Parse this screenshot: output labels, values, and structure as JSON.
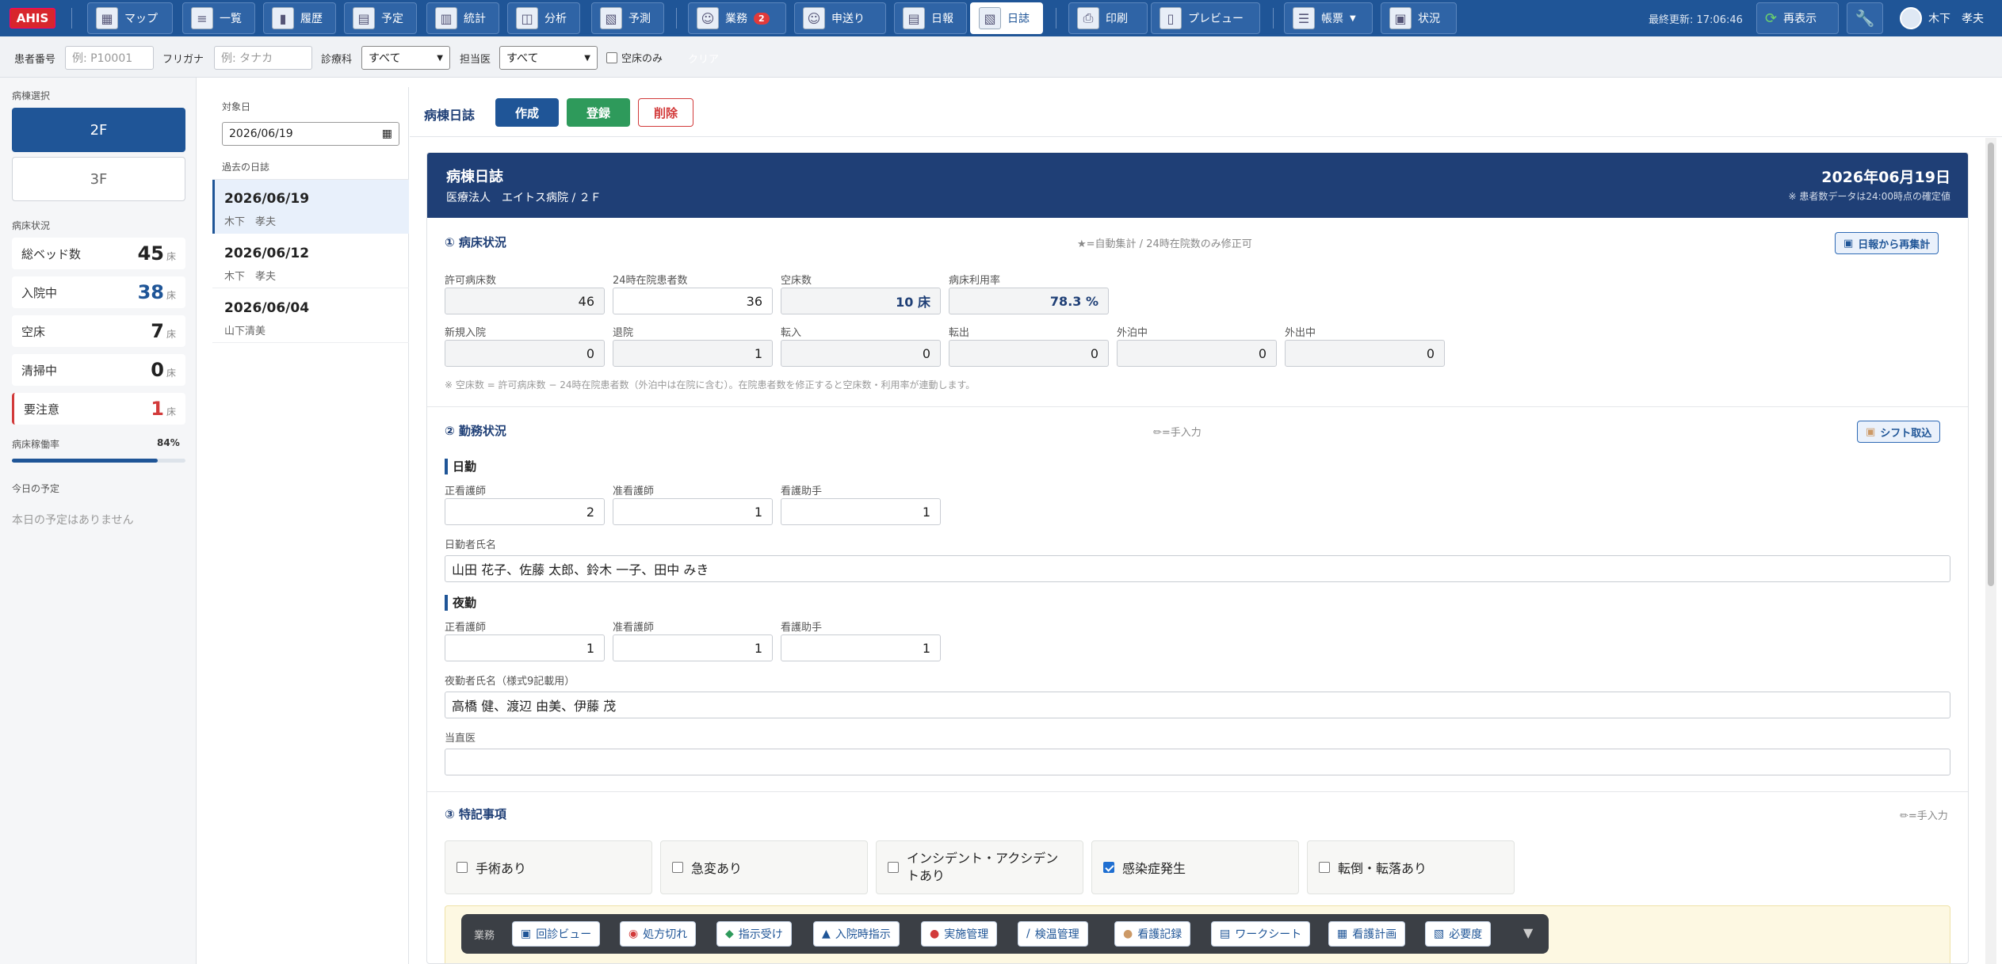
{
  "topbar": {
    "logo": "AHIS",
    "buttons": [
      {
        "label": "マップ",
        "icon": "map-icon"
      },
      {
        "label": "一覧",
        "icon": "list-icon"
      },
      {
        "label": "履歴",
        "icon": "book-icon"
      },
      {
        "label": "予定",
        "icon": "calendar-icon"
      },
      {
        "label": "統計",
        "icon": "stats-icon"
      },
      {
        "label": "分析",
        "icon": "analysis-icon"
      },
      {
        "label": "予測",
        "icon": "forecast-icon"
      },
      {
        "label": "業務",
        "icon": "nurse-icon",
        "badge": "2"
      },
      {
        "label": "申送り",
        "icon": "handover-icon"
      },
      {
        "label": "日報",
        "icon": "report-icon"
      },
      {
        "label": "日誌",
        "icon": "journal-icon",
        "active": true
      },
      {
        "label": "印刷",
        "icon": "printer-icon"
      },
      {
        "label": "プレビュー",
        "icon": "document-icon"
      },
      {
        "label": "帳票",
        "icon": "form-icon",
        "dropdown": true
      },
      {
        "label": "状況",
        "icon": "status-icon"
      }
    ],
    "last_update": "最終更新: 17:06:46",
    "refresh_label": "再表示",
    "user_name": "木下　孝夫"
  },
  "filters": {
    "patient_no_label": "患者番号",
    "patient_no_placeholder": "例: P10001",
    "furigana_label": "フリガナ",
    "furigana_placeholder": "例: タナカ",
    "department_label": "診療科",
    "department_value": "すべて",
    "doctor_label": "担当医",
    "doctor_value": "すべて",
    "vacant_only_label": "空床のみ",
    "clear_label": "クリア"
  },
  "sidebar": {
    "ward_section": "病棟選択",
    "wards": [
      "2F",
      "3F"
    ],
    "bed_section": "病床状況",
    "stats": [
      {
        "label": "総ベッド数",
        "value": "45",
        "unit": "床"
      },
      {
        "label": "入院中",
        "value": "38",
        "unit": "床"
      },
      {
        "label": "空床",
        "value": "7",
        "unit": "床"
      },
      {
        "label": "清掃中",
        "value": "0",
        "unit": "床"
      },
      {
        "label": "要注意",
        "value": "1",
        "unit": "床"
      }
    ],
    "occupancy_label": "病床稼働率",
    "occupancy_value": "84%",
    "occupancy_fraction": 0.84,
    "today_section": "今日の予定",
    "today_empty": "本日の予定はありません"
  },
  "datecol": {
    "target_label": "対象日",
    "target_date": "2026/06/19",
    "past_label": "過去の日誌",
    "entries": [
      {
        "date": "2026/06/19",
        "author": "木下　孝夫"
      },
      {
        "date": "2026/06/12",
        "author": "木下　孝夫"
      },
      {
        "date": "2026/06/04",
        "author": "山下清美"
      }
    ]
  },
  "main": {
    "title": "病棟日誌",
    "create_label": "作成",
    "register_label": "登録",
    "delete_label": "削除",
    "panel_title": "病棟日誌",
    "panel_subtitle": "医療法人　エイトス病院 / ２Ｆ",
    "panel_date": "2026年06月19日",
    "panel_note": "※ 患者数データは24:00時点の確定値",
    "sec1": {
      "title": "① 病床状況",
      "hint": "★=自動集計 / 24時在院数のみ修正可",
      "recalc_label": "日報から再集計",
      "row1": [
        {
          "label": "許可病床数",
          "value": "46"
        },
        {
          "label": "24時在院患者数",
          "value": "36"
        },
        {
          "label": "空床数",
          "value": "10 床"
        },
        {
          "label": "病床利用率",
          "value": "78.3 %"
        }
      ],
      "row2": [
        {
          "label": "新規入院",
          "value": "0"
        },
        {
          "label": "退院",
          "value": "1"
        },
        {
          "label": "転入",
          "value": "0"
        },
        {
          "label": "転出",
          "value": "0"
        },
        {
          "label": "外泊中",
          "value": "0"
        },
        {
          "label": "外出中",
          "value": "0"
        }
      ],
      "note": "※ 空床数 = 許可病床数 − 24時在院患者数（外泊中は在院に含む）。在院患者数を修正すると空床数・利用率が連動します。"
    },
    "sec2": {
      "title": "② 勤務状況",
      "hint": "✏=手入力",
      "shift_label": "シフト取込",
      "day": {
        "title": "日勤",
        "cols": [
          {
            "label": "正看護師",
            "value": "2"
          },
          {
            "label": "准看護師",
            "value": "1"
          },
          {
            "label": "看護助手",
            "value": "1"
          }
        ],
        "names_label": "日勤者氏名",
        "names": "山田 花子、佐藤 太郎、鈴木 一子、田中 みき"
      },
      "night": {
        "title": "夜勤",
        "cols": [
          {
            "label": "正看護師",
            "value": "1"
          },
          {
            "label": "准看護師",
            "value": "1"
          },
          {
            "label": "看護助手",
            "value": "1"
          }
        ],
        "names_label": "夜勤者氏名（様式9記載用）",
        "names": "高橋 健、渡辺 由美、伊藤 茂"
      },
      "doctor_label": "当直医",
      "doctor_value": ""
    },
    "sec3": {
      "title": "③ 特記事項",
      "hint": "✏=手入力",
      "items": [
        {
          "label": "手術あり",
          "checked": false
        },
        {
          "label": "急変あり",
          "checked": false
        },
        {
          "label": "インシデント・アクシデントあり",
          "checked": false
        },
        {
          "label": "感染症発生",
          "checked": true
        },
        {
          "label": "転倒・転落あり",
          "checked": false
        }
      ]
    }
  },
  "bottombar": {
    "label": "業務",
    "buttons": [
      {
        "label": "回診ビュー",
        "icon": "rounds-icon"
      },
      {
        "label": "処方切れ",
        "icon": "pill-icon"
      },
      {
        "label": "指示受け",
        "icon": "order-icon"
      },
      {
        "label": "入院時指示",
        "icon": "admission-icon"
      },
      {
        "label": "実施管理",
        "icon": "task-icon"
      },
      {
        "label": "検温管理",
        "icon": "thermometer-icon"
      },
      {
        "label": "看護記録",
        "icon": "nursing-record-icon"
      },
      {
        "label": "ワークシート",
        "icon": "worksheet-icon"
      },
      {
        "label": "看護計画",
        "icon": "plan-icon"
      },
      {
        "label": "必要度",
        "icon": "severity-icon"
      }
    ]
  }
}
